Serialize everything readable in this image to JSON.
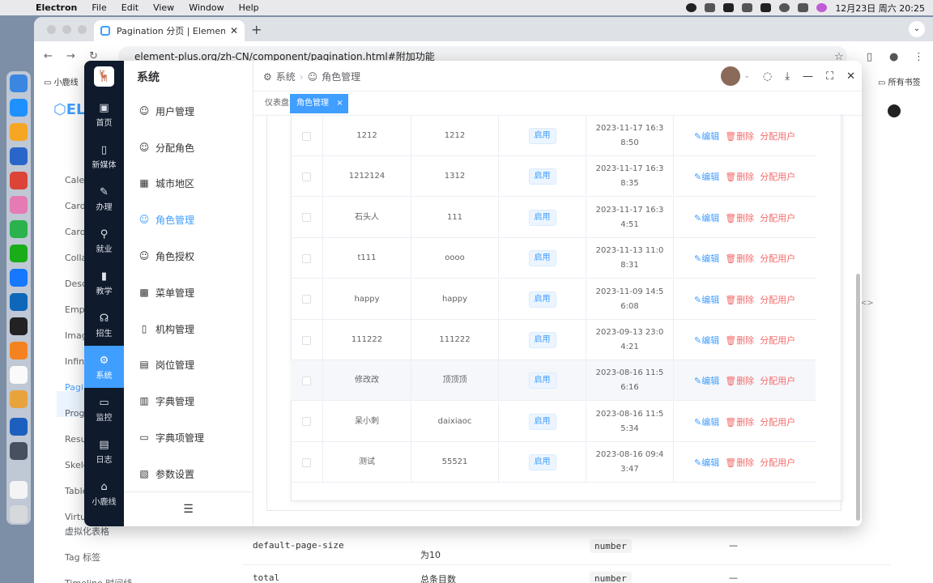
{
  "menubar": {
    "app": "Electron",
    "items": [
      "File",
      "Edit",
      "View",
      "Window",
      "Help"
    ],
    "datetime": "12月23日 周六  20:25"
  },
  "browser": {
    "tab_title": "Pagination 分页 | Element Plus",
    "url": "element-plus.org/zh-CN/component/pagination.html#附加功能",
    "bookmark_left": "小鹿线",
    "bookmark_right": "所有书签"
  },
  "docpage": {
    "logo": "EL",
    "side_links": [
      "Calen",
      "Card",
      "Caro",
      "Colla",
      "Desc",
      "Empt",
      "Imag",
      "Infini",
      "Pagi",
      "Prog",
      "Resu",
      "Skele",
      "Table",
      "Virtu",
      "虚拟化表格",
      "Tag 标签",
      "Timeline 时间线"
    ],
    "rows": [
      {
        "name": "default-page-size",
        "desc": "为10",
        "type": "number",
        "default": "—"
      },
      {
        "name": "total",
        "desc": "总条目数",
        "type": "number",
        "default": "—"
      }
    ],
    "code_toggle": "<>"
  },
  "app": {
    "logo": "🦌",
    "rail": [
      {
        "icon": "▣",
        "label": "首页"
      },
      {
        "icon": "▯",
        "label": "新媒体"
      },
      {
        "icon": "✎",
        "label": "办理"
      },
      {
        "icon": "⚲",
        "label": "就业"
      },
      {
        "icon": "▮",
        "label": "教学"
      },
      {
        "icon": "☊",
        "label": "招生"
      },
      {
        "icon": "⚙",
        "label": "系统"
      },
      {
        "icon": "▭",
        "label": "监控"
      },
      {
        "icon": "▤",
        "label": "日志"
      },
      {
        "icon": "⌂",
        "label": "小鹿线"
      }
    ],
    "submenu": {
      "title": "系统",
      "items": [
        {
          "icon": "☺",
          "label": "用户管理"
        },
        {
          "icon": "☺",
          "label": "分配角色"
        },
        {
          "icon": "▦",
          "label": "城市地区"
        },
        {
          "icon": "☺",
          "label": "角色管理"
        },
        {
          "icon": "☺",
          "label": "角色授权"
        },
        {
          "icon": "▩",
          "label": "菜单管理"
        },
        {
          "icon": "▯",
          "label": "机构管理"
        },
        {
          "icon": "▤",
          "label": "岗位管理"
        },
        {
          "icon": "▥",
          "label": "字典管理"
        },
        {
          "icon": "▭",
          "label": "字典项管理"
        },
        {
          "icon": "▧",
          "label": "参数设置"
        }
      ],
      "collapse_icon": "☰"
    },
    "breadcrumb": {
      "root": "系统",
      "current": "角色管理"
    },
    "header_icons": {
      "chat": "◌",
      "download": "⤓",
      "minimize": "—",
      "maximize": "⛶",
      "close": "✕"
    },
    "tags": {
      "home": "仪表盘",
      "current": "角色管理",
      "close": "×"
    },
    "table": {
      "rows": [
        {
          "name": "1212",
          "code": "1212",
          "status": "启用",
          "time": "2023-11-17 16:38:50"
        },
        {
          "name": "1212124",
          "code": "1312",
          "status": "启用",
          "time": "2023-11-17 16:38:35"
        },
        {
          "name": "石头人",
          "code": "111",
          "status": "启用",
          "time": "2023-11-17 16:34:51"
        },
        {
          "name": "t111",
          "code": "oooo",
          "status": "启用",
          "time": "2023-11-13 11:08:31"
        },
        {
          "name": "happy",
          "code": "happy",
          "status": "启用",
          "time": "2023-11-09 14:56:08"
        },
        {
          "name": "111222",
          "code": "111222",
          "status": "启用",
          "time": "2023-09-13 23:04:21"
        },
        {
          "name": "修改改",
          "code": "顶顶顶",
          "status": "启用",
          "time": "2023-08-16 11:56:16"
        },
        {
          "name": "呆小刺",
          "code": "daixiaoc",
          "status": "启用",
          "time": "2023-08-16 11:55:34"
        },
        {
          "name": "测试",
          "code": "55521",
          "status": "启用",
          "time": "2023-08-16 09:43:47"
        }
      ],
      "ops": {
        "edit": "编辑",
        "delete": "删除",
        "assign": "分配用户"
      }
    }
  },
  "colors": {
    "primary": "#409eff",
    "danger": "#f56c6c",
    "rail_bg": "#0f1a2c"
  }
}
